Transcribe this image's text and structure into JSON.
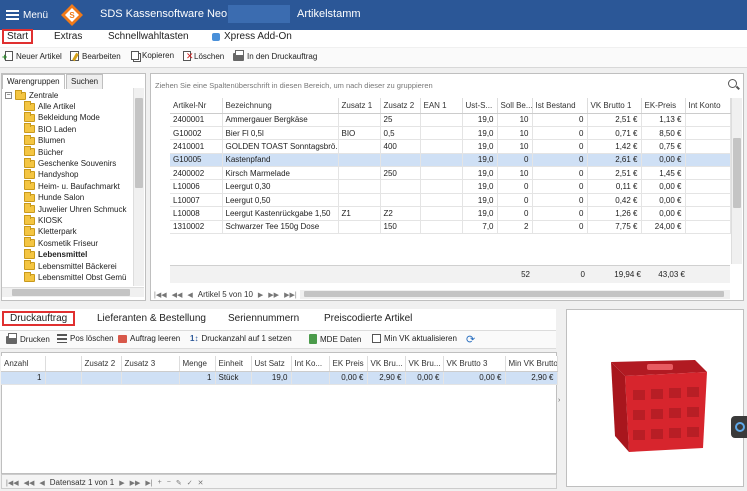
{
  "titlebar": {
    "menu_label": "Menü",
    "app_title": "SDS Kassensoftware Neo",
    "module": "Artikelstamm"
  },
  "ribbon": {
    "tabs": [
      "Start",
      "Extras",
      "Schnellwahltasten",
      "Xpress Add-On"
    ],
    "active_tab": "Start"
  },
  "toolbar": {
    "new": "Neuer Artikel",
    "edit": "Bearbeiten",
    "copy": "Kopieren",
    "delete": "Löschen",
    "to_print": "In den Druckauftrag"
  },
  "left_panel": {
    "tabs": [
      "Warengruppen",
      "Suchen"
    ],
    "root": "Zentrale",
    "items": [
      "Alle Artikel",
      "Bekleidung Mode",
      "BIO Laden",
      "Blumen",
      "Bücher",
      "Geschenke Souvenirs",
      "Handyshop",
      "Heim- u. Baufachmarkt",
      "Hunde Salon",
      "Juwelier Uhren Schmuck",
      "KIOSK",
      "Kletterpark",
      "Kosmetik Friseur",
      "Lebensmittel",
      "Lebensmittel Bäckerei",
      "Lebensmittel Obst Gemü"
    ],
    "selected_item": "Lebensmittel"
  },
  "main_grid": {
    "group_hint": "Ziehen Sie eine Spaltenüberschrift in diesen Bereich, um nach dieser zu gruppieren",
    "columns": [
      "Artikel-Nr",
      "Bezeichnung",
      "Zusatz 1",
      "Zusatz 2",
      "EAN 1",
      "Ust-S...",
      "Soll Be...",
      "Ist Bestand",
      "VK Brutto 1",
      "EK-Preis",
      "Int Konto"
    ],
    "rows": [
      [
        "2400001",
        "Ammergauer Bergkäse",
        "",
        "25",
        "",
        "19,0",
        "10",
        "0",
        "2,51 €",
        "1,13 €",
        ""
      ],
      [
        "G10002",
        "Bier Fl 0,5l",
        "BIO",
        "0,5",
        "",
        "19,0",
        "10",
        "0",
        "0,71 €",
        "8,50 €",
        ""
      ],
      [
        "2410001",
        "GOLDEN TOAST Sonntagsbrö...",
        "",
        "400",
        "",
        "19,0",
        "10",
        "0",
        "1,42 €",
        "0,75 €",
        ""
      ],
      [
        "G10005",
        "Kastenpfand",
        "",
        "",
        "",
        "19,0",
        "0",
        "0",
        "2,61 €",
        "0,00 €",
        ""
      ],
      [
        "2400002",
        "Kirsch Marmelade",
        "",
        "250",
        "",
        "19,0",
        "10",
        "0",
        "2,51 €",
        "1,45 €",
        ""
      ],
      [
        "L10006",
        "Leergut 0,30",
        "",
        "",
        "",
        "19,0",
        "0",
        "0",
        "0,11 €",
        "0,00 €",
        ""
      ],
      [
        "L10007",
        "Leergut 0,50",
        "",
        "",
        "",
        "19,0",
        "0",
        "0",
        "0,42 €",
        "0,00 €",
        ""
      ],
      [
        "L10008",
        "Leergut Kastenrückgabe 1,50",
        "Z1",
        "Z2",
        "",
        "19,0",
        "0",
        "0",
        "1,26 €",
        "0,00 €",
        ""
      ],
      [
        "1310002",
        "Schwarzer Tee 150g Dose",
        "",
        "150",
        "",
        "7,0",
        "2",
        "0",
        "7,75 €",
        "24,00 €",
        ""
      ]
    ],
    "selected_row": 3,
    "totals": {
      "soll": "52",
      "ist": "0",
      "vk": "19,94 €",
      "ek": "43,03 €"
    },
    "nav_text": "Artikel 5 von 10"
  },
  "bottom_tabs": [
    "Druckauftrag",
    "Lieferanten & Bestellung",
    "Seriennummern",
    "Preiscodierte Artikel"
  ],
  "bottom_toolbar": {
    "print": "Drucken",
    "delete_pos": "Pos löschen",
    "clear": "Auftrag leeren",
    "set_count": "Druckanzahl auf 1 setzen",
    "mde": "MDE Daten",
    "update_vk": "Min VK aktualisieren"
  },
  "bottom_grid": {
    "columns": [
      "Anzahl",
      "",
      "Zusatz 2",
      "Zusatz 3",
      "Menge",
      "Einheit",
      "Ust Satz",
      "Int Ko...",
      "EK Preis",
      "VK Bru...",
      "VK Bru...",
      "VK Brutto 3",
      "Min VK Brutto"
    ],
    "rows": [
      [
        "1",
        "",
        "",
        "",
        "1",
        "Stück",
        "19,0",
        "",
        "0,00 €",
        "2,90 €",
        "0,00 €",
        "0,00 €",
        "2,90 €"
      ]
    ],
    "nav_text": "Datensatz 1 von 1"
  },
  "colors": {
    "titlebar": "#2b5797",
    "selection": "#cfe0f5",
    "crate": "#d7252d",
    "highlight": "#e03030"
  }
}
